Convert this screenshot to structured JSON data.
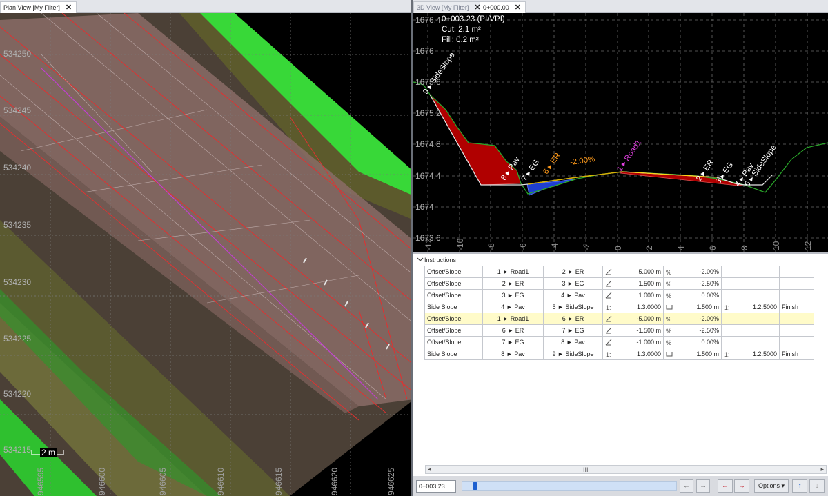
{
  "tabs": {
    "plan": {
      "label": "Plan View [My Filter]",
      "close": "✕"
    },
    "view3d": {
      "label": "3D View [My Filter]",
      "close": "✕"
    },
    "station": {
      "label": "0+000.00",
      "close": "✕"
    }
  },
  "plan_view": {
    "northings": [
      "534250",
      "534245",
      "534240",
      "534235",
      "534230",
      "534225",
      "534220",
      "534215"
    ],
    "eastings": [
      "946595",
      "946600",
      "946605",
      "946610",
      "946615",
      "946620",
      "946625"
    ],
    "scale_label": "2 m"
  },
  "view3d": {
    "station": "0+003.23 (PI/VPI)",
    "cut": "Cut: 2.1 m²",
    "fill": "Fill: 0.2 m²",
    "elevations": [
      "1676.4",
      "1676",
      "1675.6",
      "1675.2",
      "1674.8",
      "1674.4",
      "1674",
      "1673.6"
    ],
    "offsets": [
      "-12",
      "-10",
      "-8",
      "-6",
      "-4",
      "-2",
      "0",
      "2",
      "4",
      "6",
      "8",
      "10",
      "12"
    ],
    "point_labels": [
      {
        "text": "9 ▸ SideSlope",
        "color": "#ffffff"
      },
      {
        "text": "8 ▸ Pav",
        "color": "#ffffff"
      },
      {
        "text": "7 ▸ EG",
        "color": "#ffffff"
      },
      {
        "text": "6 ▸ ER",
        "color": "#ff9a1a"
      },
      {
        "text": "-2.00%",
        "color": "#ff9a1a"
      },
      {
        "text": "1 ▸ Road1",
        "color": "#e040e0"
      },
      {
        "text": "2 ▸ ER",
        "color": "#ffffff"
      },
      {
        "text": "3 ▸ EG",
        "color": "#ffffff"
      },
      {
        "text": "4 ▸ Pav",
        "color": "#ffffff"
      },
      {
        "text": "5 ▸ SideSlope",
        "color": "#ffffff"
      }
    ]
  },
  "instructions": {
    "title": "Instructions",
    "rows": [
      {
        "type": "Offset/Slope",
        "from": "1 ► Road1",
        "to": "2 ► ER",
        "value1": "5.000 m",
        "value2": "-2.00%",
        "value3": "",
        "value4": "",
        "finish": "",
        "selected": false
      },
      {
        "type": "Offset/Slope",
        "from": "2 ► ER",
        "to": "3 ► EG",
        "value1": "1.500 m",
        "value2": "-2.50%",
        "value3": "",
        "value4": "",
        "finish": "",
        "selected": false
      },
      {
        "type": "Offset/Slope",
        "from": "3 ► EG",
        "to": "4 ► Pav",
        "value1": "1.000 m",
        "value2": "0.00%",
        "value3": "",
        "value4": "",
        "finish": "",
        "selected": false
      },
      {
        "type": "Side Slope",
        "from": "4 ► Pav",
        "to": "5 ► SideSlope",
        "value1": "1:3.0000",
        "value2": "1.500 m",
        "value3": "1:2.5000",
        "value4": "",
        "finish": "Finish",
        "selected": false
      },
      {
        "type": "Offset/Slope",
        "from": "1 ► Road1",
        "to": "6 ► ER",
        "value1": "-5.000 m",
        "value2": "-2.00%",
        "value3": "",
        "value4": "",
        "finish": "",
        "selected": true
      },
      {
        "type": "Offset/Slope",
        "from": "6 ► ER",
        "to": "7 ► EG",
        "value1": "-1.500 m",
        "value2": "-2.50%",
        "value3": "",
        "value4": "",
        "finish": "",
        "selected": false
      },
      {
        "type": "Offset/Slope",
        "from": "7 ► EG",
        "to": "8 ► Pav",
        "value1": "-1.000 m",
        "value2": "0.00%",
        "value3": "",
        "value4": "",
        "finish": "",
        "selected": false
      },
      {
        "type": "Side Slope",
        "from": "8 ► Pav",
        "to": "9 ► SideSlope",
        "value1": "1:3.0000",
        "value2": "1.500 m",
        "value3": "1:2.5000",
        "value4": "",
        "finish": "Finish",
        "selected": false
      }
    ]
  },
  "toolbar": {
    "station_value": "0+003.23",
    "scroll_label": "III",
    "options_label": "Options ▾",
    "prev_icon": "arrow-left-icon",
    "next_icon": "arrow-right-icon",
    "prev_red_icon": "arrow-left-red-icon",
    "next_red_icon": "arrow-right-red-icon",
    "up_icon": "arrow-up-icon",
    "down_icon": "arrow-down-icon"
  }
}
